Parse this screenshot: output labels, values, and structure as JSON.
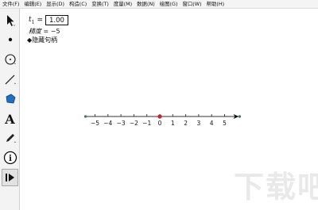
{
  "menu": {
    "items": [
      "文件(F)",
      "编辑(E)",
      "显示(D)",
      "构造(C)",
      "变换(T)",
      "度量(M)",
      "数据(N)",
      "绘图(G)",
      "窗口(W)",
      "帮助(H)"
    ]
  },
  "toolbar": {
    "tools": [
      "arrow-select-tool",
      "point-tool",
      "compass-tool",
      "straightedge-tool",
      "polygon-tool",
      "text-tool",
      "marker-tool",
      "information-tool",
      "custom-tool"
    ],
    "text_tool_glyph": "A",
    "info_tool_glyph": "i"
  },
  "canvas": {
    "parameter": {
      "name": "t",
      "subscript": "1",
      "equals": "=",
      "value": "1.00"
    },
    "precision": {
      "label": "精度",
      "equals": " = ",
      "value": "−5"
    },
    "hide_handle": "◆隐藏句柄",
    "number_line": {
      "tick_labels": [
        "−5",
        "−4",
        "−3",
        "−2",
        "−1",
        "0",
        "1",
        "2",
        "3",
        "4",
        "5"
      ]
    }
  },
  "watermark": {
    "text": "下载吧"
  },
  "colors": {
    "menu_bg": "#f4f4f4",
    "toolbar_bg": "#f3f3f3",
    "axis": "#333333",
    "origin_point": "#c62828",
    "end_point": "#2e7d5b"
  }
}
